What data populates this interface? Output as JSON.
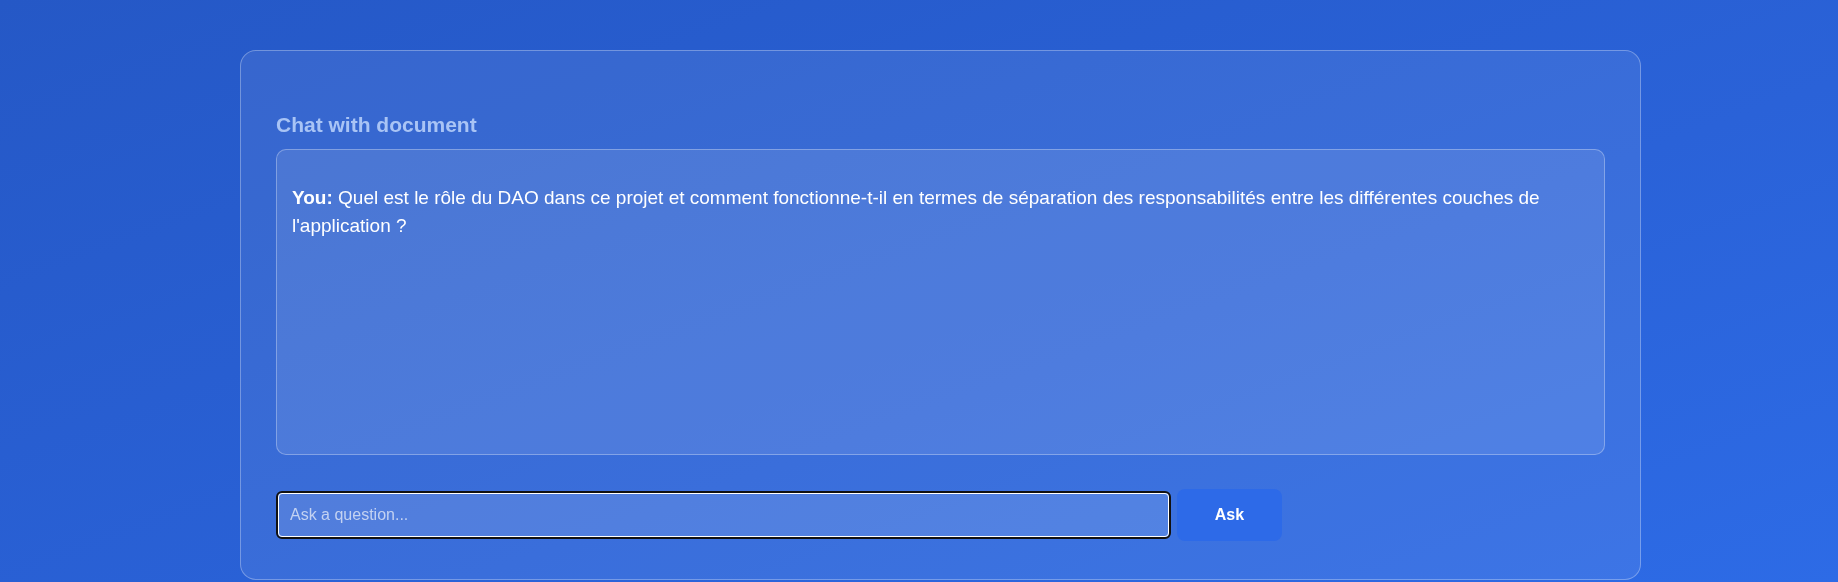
{
  "title": "Chat with document",
  "messages": [
    {
      "text": "**You:** Quel est le rôle du DAO dans ce projet et comment fonctionne-t-il en termes de séparation des responsabilités entre les différentes couches de l'application ?"
    }
  ],
  "question": {
    "placeholder": "Ask a question..."
  },
  "ask_button": "Ask"
}
